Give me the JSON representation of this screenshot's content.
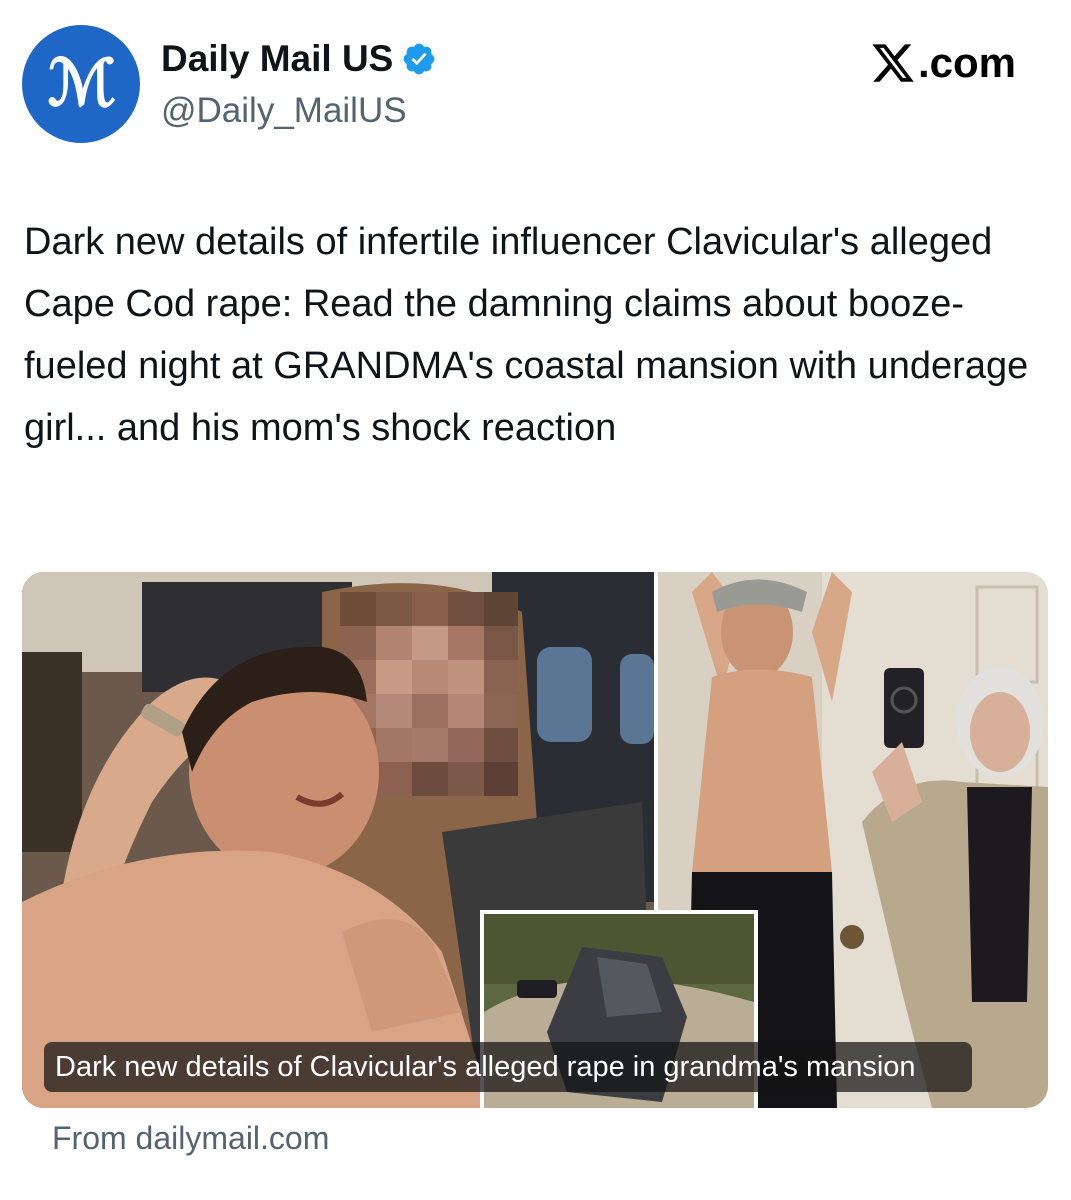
{
  "account": {
    "avatar_letter": "M",
    "display_name": "Daily Mail US",
    "verified": true,
    "verified_color": "#1d9bf0",
    "handle": "@Daily_MailUS",
    "avatar_color": "#1f67c7"
  },
  "platform": {
    "name": "X.com",
    "logo_letter": "X",
    "wordmark_suffix": ".com"
  },
  "tweet": {
    "text": "Dark new details of infertile influencer Clavicular's alleged Cape Cod rape: Read the damning claims about booze-fueled night at GRANDMA's coastal mansion with underage girl... and his mom's shock reaction"
  },
  "media": {
    "caption": "Dark new details of Clavicular's alleged rape in grandma's mansion"
  },
  "link_card": {
    "source": "From dailymail.com"
  },
  "colors": {
    "text_primary": "#0f1419",
    "text_secondary": "#536471",
    "background": "#ffffff"
  }
}
